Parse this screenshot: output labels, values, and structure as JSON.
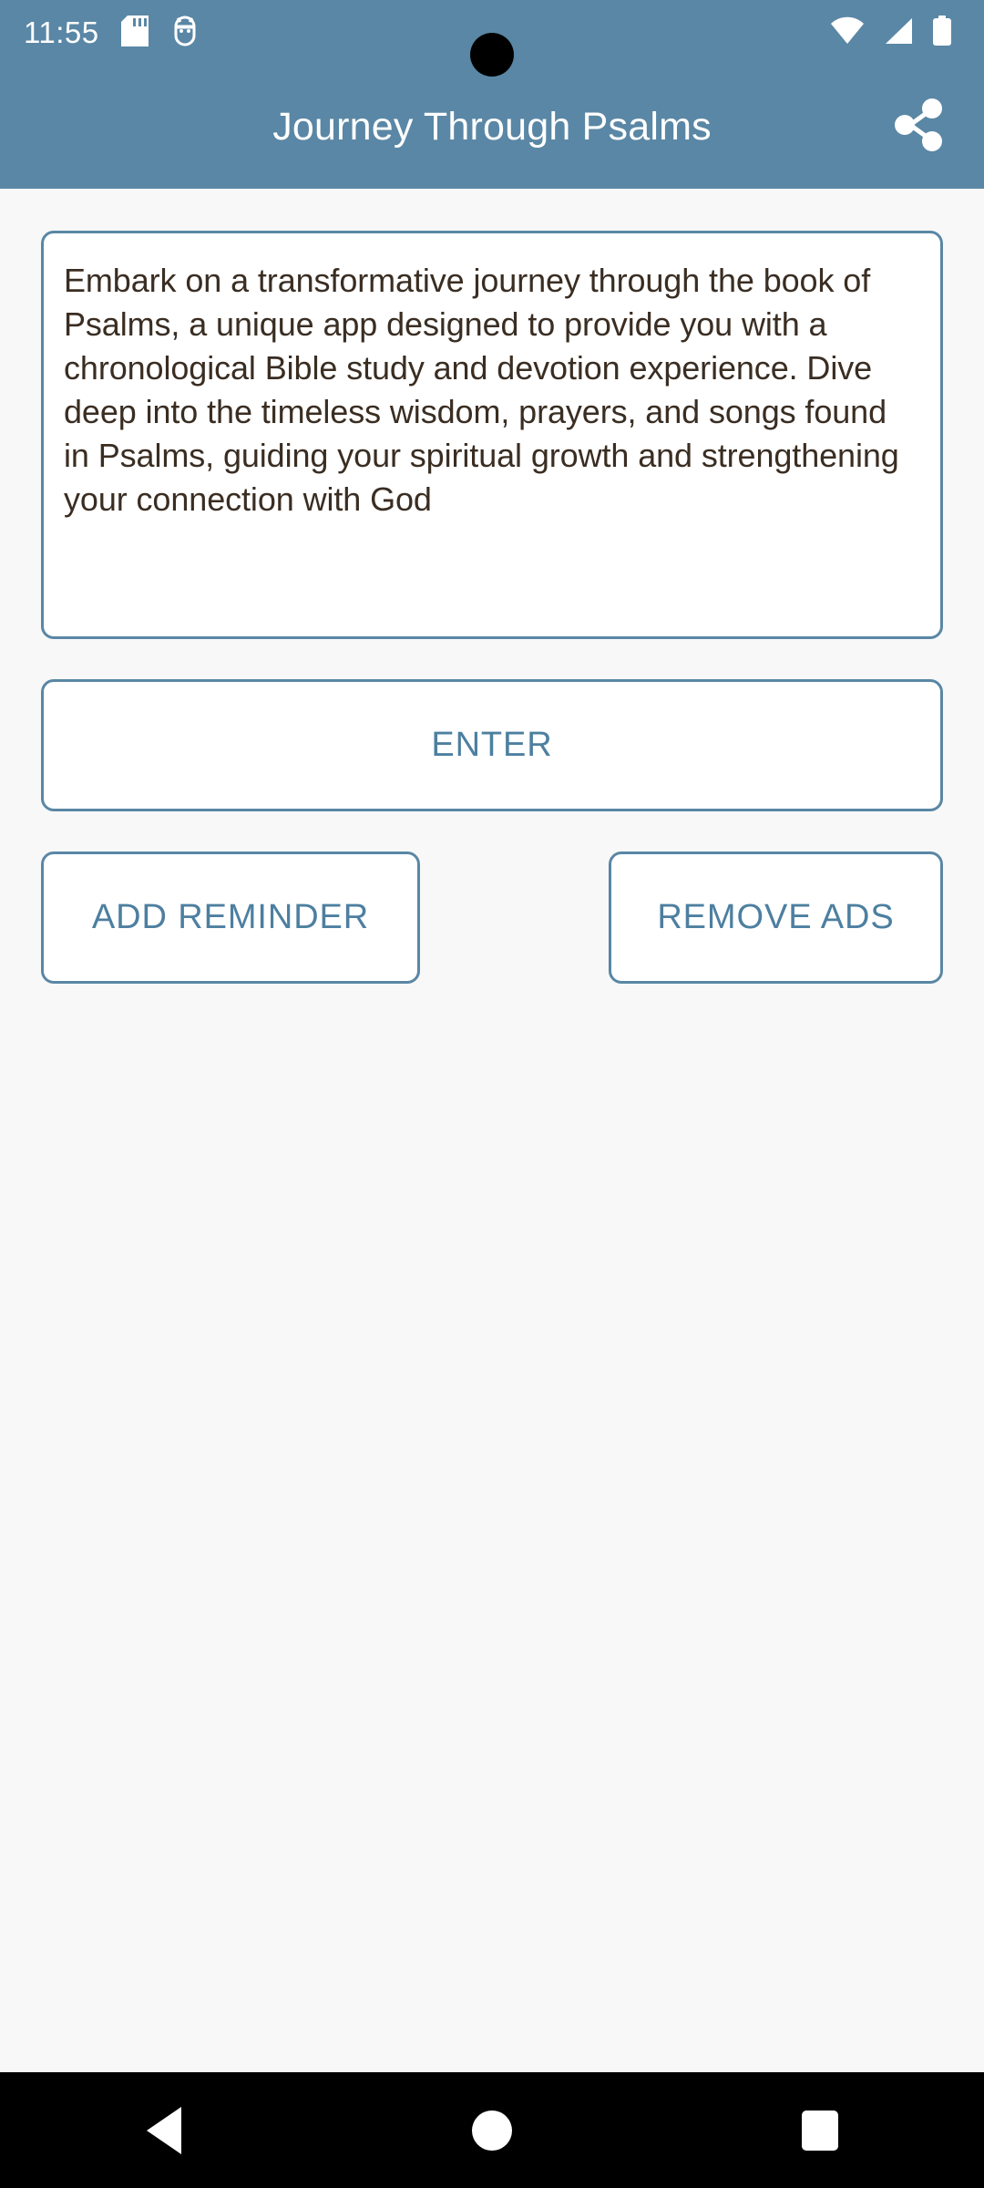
{
  "status_bar": {
    "clock": "11:55",
    "left_icons": [
      {
        "name": "sd-card-icon"
      },
      {
        "name": "android-debug-icon"
      }
    ],
    "right_icons": [
      {
        "name": "wifi-icon"
      },
      {
        "name": "cellular-signal-icon"
      },
      {
        "name": "battery-icon"
      }
    ]
  },
  "app_bar": {
    "title": "Journey Through Psalms",
    "share_icon": "share-icon",
    "background_color": "#5A87A5",
    "title_color": "#FFFFFF"
  },
  "main": {
    "description": "Embark on a transformative journey through the book of Psalms, a unique app designed to provide you with a chronological Bible study and devotion experience. Dive deep into the timeless wisdom, prayers, and songs found in Psalms, guiding your spiritual growth and strengthening your connection with God",
    "buttons": {
      "enter_label": "ENTER",
      "add_reminder_label": "ADD REMINDER",
      "remove_ads_label": "REMOVE ADS"
    },
    "accent_color": "#5A87A5",
    "button_text_color": "#4D7FA0",
    "background_color": "#F8F8F8",
    "description_text_color": "#3A2D22"
  },
  "navigation_bar": {
    "background_color": "#000000",
    "keys": [
      {
        "name": "back-key",
        "icon": "triangle-left-icon"
      },
      {
        "name": "home-key",
        "icon": "circle-icon"
      },
      {
        "name": "recents-key",
        "icon": "square-icon"
      }
    ]
  }
}
